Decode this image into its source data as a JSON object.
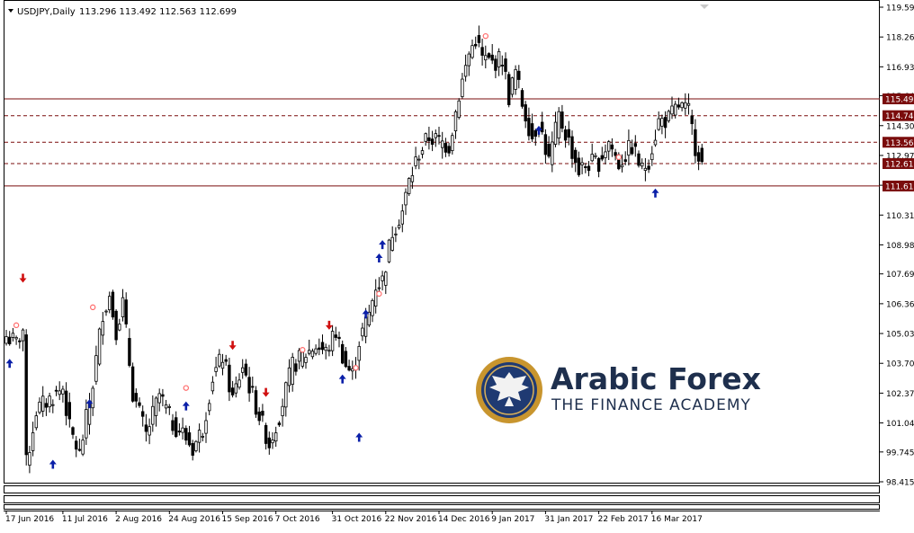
{
  "header": {
    "symbol_line": "USDJPY,Daily",
    "ohlc_line": "113.296 113.492 112.563 112.699"
  },
  "watermark": {
    "brand": "Arabic Forex",
    "tagline": "THE FINANCE ACADEMY",
    "colors": {
      "brand": "#1e2f4d",
      "gold": "#c8952e",
      "emblem_blue": "#1f3a72"
    },
    "icon": "eagle-emblem-icon"
  },
  "colors": {
    "candle_body": "#000000",
    "solid_level": "#7a0c0c",
    "dashed_level": "#7a0c0c",
    "up_arrow": "#0a1fa8",
    "down_arrow": "#d01010",
    "pattern_marker": "#ff6a6a"
  },
  "chart_data": {
    "type": "candlestick",
    "symbol": "USDJPY",
    "timeframe": "Daily",
    "last_bar": {
      "open": 113.296,
      "high": 113.492,
      "low": 112.563,
      "close": 112.699
    },
    "y_ticks": [
      "119.590",
      "118.260",
      "116.930",
      "115.645",
      "114.305",
      "112.975",
      "111.645",
      "110.315",
      "108.985",
      "107.690",
      "106.360",
      "105.030",
      "103.700",
      "102.370",
      "101.040",
      "99.745",
      "98.415"
    ],
    "ylim": [
      98.3,
      119.65
    ],
    "x_ticks": [
      "17 Jun 2016",
      "11 Jul 2016",
      "2 Aug 2016",
      "24 Aug 2016",
      "15 Sep 2016",
      "7 Oct 2016",
      "31 Oct 2016",
      "22 Nov 2016",
      "14 Dec 2016",
      "9 Jan 2017",
      "31 Jan 2017",
      "22 Feb 2017",
      "16 Mar 2017"
    ],
    "levels": [
      {
        "price": 115.499,
        "label": "115.499",
        "style": "solid"
      },
      {
        "price": 114.749,
        "label": "114.749",
        "style": "dashed"
      },
      {
        "price": 113.564,
        "label": "113.564",
        "style": "dashed"
      },
      {
        "price": 112.611,
        "label": "112.611",
        "style": "dashed"
      },
      {
        "price": 111.612,
        "label": "111.612",
        "style": "solid"
      }
    ],
    "anchors": [
      [
        0,
        104.9
      ],
      [
        3,
        104.6
      ],
      [
        5,
        105.2
      ],
      [
        6,
        99.2
      ],
      [
        9,
        101.6
      ],
      [
        17,
        102.6
      ],
      [
        19,
        100.8
      ],
      [
        22,
        99.6
      ],
      [
        26,
        102.8
      ],
      [
        29,
        106.0
      ],
      [
        31,
        106.7
      ],
      [
        33,
        105.2
      ],
      [
        35,
        106.4
      ],
      [
        38,
        102.4
      ],
      [
        42,
        100.5
      ],
      [
        46,
        102.3
      ],
      [
        50,
        101.0
      ],
      [
        53,
        100.6
      ],
      [
        56,
        99.9
      ],
      [
        59,
        100.8
      ],
      [
        62,
        103.1
      ],
      [
        65,
        104.0
      ],
      [
        68,
        102.1
      ],
      [
        71,
        103.6
      ],
      [
        75,
        101.8
      ],
      [
        79,
        100.1
      ],
      [
        82,
        101.4
      ],
      [
        86,
        103.6
      ],
      [
        89,
        104.0
      ],
      [
        93,
        104.5
      ],
      [
        96,
        104.2
      ],
      [
        99,
        105.1
      ],
      [
        102,
        103.6
      ],
      [
        104,
        103.2
      ],
      [
        106,
        104.7
      ],
      [
        109,
        105.9
      ],
      [
        111,
        107.2
      ],
      [
        113,
        107.4
      ],
      [
        116,
        109.6
      ],
      [
        119,
        110.5
      ],
      [
        121,
        111.8
      ],
      [
        124,
        113.1
      ],
      [
        127,
        113.8
      ],
      [
        130,
        113.6
      ],
      [
        133,
        113.4
      ],
      [
        136,
        115.7
      ],
      [
        139,
        117.5
      ],
      [
        141,
        118.2
      ],
      [
        143,
        117.3
      ],
      [
        146,
        117.1
      ],
      [
        149,
        117.3
      ],
      [
        151,
        115.6
      ],
      [
        153,
        116.7
      ],
      [
        155,
        115.3
      ],
      [
        158,
        113.8
      ],
      [
        160,
        114.5
      ],
      [
        163,
        112.7
      ],
      [
        166,
        114.7
      ],
      [
        169,
        113.6
      ],
      [
        172,
        112.3
      ],
      [
        175,
        112.6
      ],
      [
        178,
        112.7
      ],
      [
        181,
        113.6
      ],
      [
        184,
        112.6
      ],
      [
        188,
        113.4
      ],
      [
        191,
        112.3
      ],
      [
        193,
        112.8
      ],
      [
        196,
        114.5
      ],
      [
        199,
        114.6
      ],
      [
        202,
        115.2
      ],
      [
        205,
        114.9
      ],
      [
        207,
        113.4
      ],
      [
        209,
        112.8
      ]
    ],
    "up_arrows": [
      [
        1,
        103.9
      ],
      [
        14,
        99.4
      ],
      [
        25,
        102.1
      ],
      [
        54,
        102.0
      ],
      [
        101,
        103.2
      ],
      [
        106,
        100.6
      ],
      [
        108,
        106.1
      ],
      [
        112,
        108.6
      ],
      [
        113,
        109.2
      ],
      [
        160,
        114.3
      ],
      [
        195,
        111.5
      ]
    ],
    "down_arrows": [
      [
        5,
        107.3
      ],
      [
        68,
        104.3
      ],
      [
        78,
        102.2
      ],
      [
        97,
        105.2
      ]
    ],
    "markers": [
      [
        3,
        105.4
      ],
      [
        26,
        106.2
      ],
      [
        54,
        102.6
      ],
      [
        89,
        104.3
      ],
      [
        105,
        103.5
      ],
      [
        112,
        106.8
      ],
      [
        144,
        118.3
      ],
      [
        184,
        112.9
      ]
    ]
  }
}
